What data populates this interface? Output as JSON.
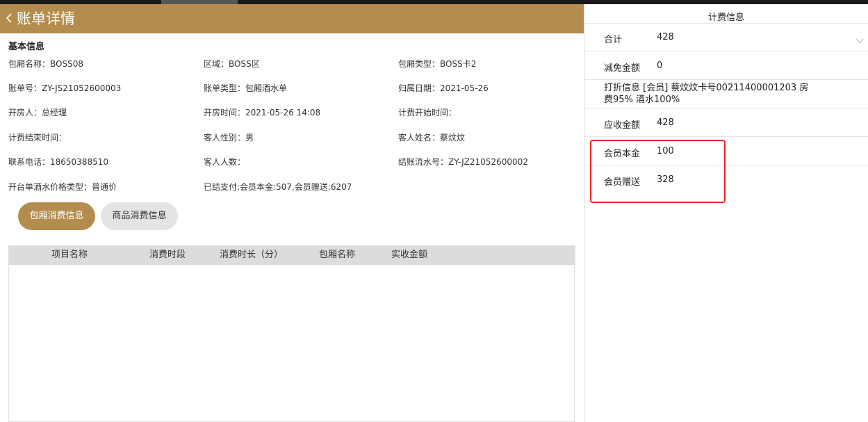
{
  "header": {
    "title": "账单详情"
  },
  "basic": {
    "section_title": "基本信息",
    "fields": [
      "包厢名称：BOSS08",
      "区域：BOSS区",
      "包厢类型：BOSS卡2",
      "账单号：ZY-JS21052600003",
      "账单类型：包厢酒水单",
      "归属日期：2021-05-26",
      "开房人：总经理",
      "开房时间：2021-05-26 14:08",
      "计费开始时间：",
      "计费结束时间：",
      "客人性别：男",
      "客人姓名：蔡炆炆",
      "联系电话：18650388510",
      "客人人数：",
      "结账流水号：ZY-JZ21052600002",
      "开台单酒水价格类型：普通价",
      "已结支付:会员本金:507,会员赠送:6207"
    ]
  },
  "tabs": {
    "room": "包厢消费信息",
    "goods": "商品消费信息"
  },
  "table": {
    "headers": [
      "项目名称",
      "消费时段",
      "消费时长（分）",
      "包厢名称",
      "实收金额"
    ]
  },
  "billing": {
    "title": "计费信息",
    "total_label": "合计",
    "total_value": "428",
    "discount_label": "减免金额",
    "discount_value": "0",
    "discount_info_line1": "打折信息 [会员] 蔡炆炆卡号00211400001203 房",
    "discount_info_line2": "费95% 酒水100%",
    "receivable_label": "应收金额",
    "receivable_value": "428",
    "principal_label": "会员本金",
    "principal_value": "100",
    "gift_label": "会员赠送",
    "gift_value": "328"
  },
  "colors": {
    "brand": "#b28d4e",
    "highlight": "#ee2222"
  }
}
